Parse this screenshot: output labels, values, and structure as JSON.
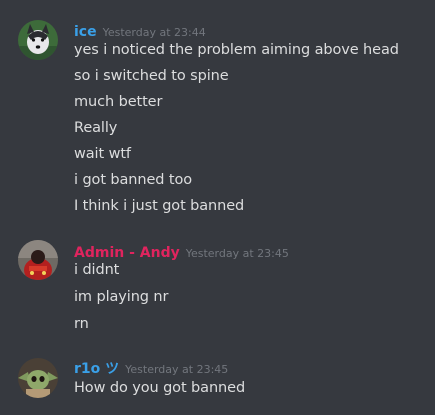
{
  "colors": {
    "background": "#36393f",
    "text": "#dcddde",
    "timestamp": "#72767d"
  },
  "groups": [
    {
      "username": "ice",
      "username_color": "#3aa0e8",
      "timestamp": "Yesterday at 23:44",
      "avatar_icon": "husky-dog-avatar",
      "messages": [
        "yes i noticed the problem aiming above head",
        "so i switched to spine",
        "much better",
        "Really",
        "wait wtf",
        "i got banned too",
        "I think i just got banned"
      ]
    },
    {
      "username": "Admin - Andy",
      "username_color": "#e0245e",
      "timestamp": "Yesterday at 23:45",
      "avatar_icon": "red-character-avatar",
      "messages": [
        "i didnt",
        "im playing nr",
        "rn"
      ]
    },
    {
      "username": "r1o ツ",
      "username_color": "#3aa0e8",
      "timestamp": "Yesterday at 23:45",
      "avatar_icon": "baby-yoda-avatar",
      "messages": [
        "How do you got banned"
      ]
    }
  ]
}
